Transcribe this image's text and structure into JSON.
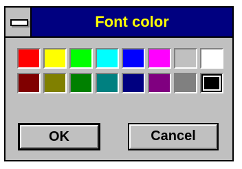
{
  "window": {
    "title": "Font color",
    "system_menu_icon": "system-menu-dash-icon"
  },
  "palette": {
    "colors_row1": [
      "#ff0000",
      "#ffff00",
      "#00ff00",
      "#00ffff",
      "#0000ff",
      "#ff00ff",
      "#c0c0c0",
      "#ffffff"
    ],
    "colors_row2": [
      "#800000",
      "#808000",
      "#008000",
      "#008080",
      "#000080",
      "#800080",
      "#808080",
      "#000000"
    ],
    "selected_color": "#000000"
  },
  "buttons": {
    "ok_label": "OK",
    "cancel_label": "Cancel"
  }
}
